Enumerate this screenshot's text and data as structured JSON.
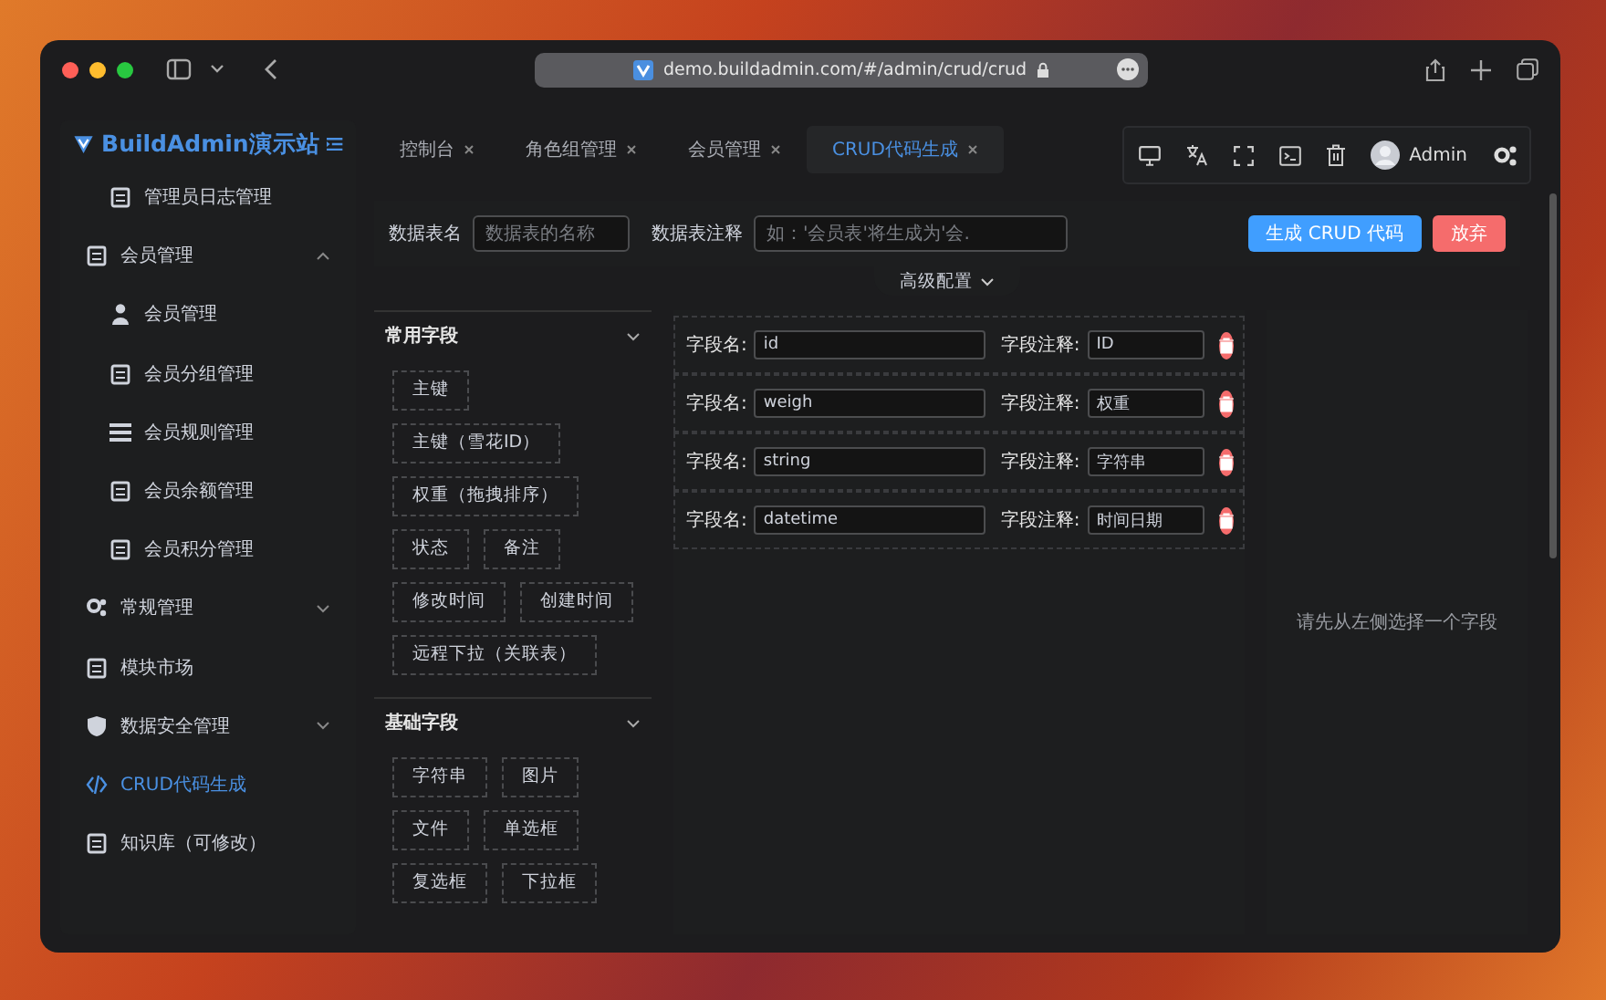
{
  "browser": {
    "url": "demo.buildadmin.com/#/admin/crud/crud"
  },
  "sidebar": {
    "logo": "BuildAdmin演示站",
    "items": [
      {
        "label": "管理员日志管理",
        "kind": "sub",
        "selected": false
      },
      {
        "label": "会员管理",
        "kind": "group",
        "expanded": true,
        "selected": false,
        "children": [
          {
            "label": "会员管理",
            "kind": "sub",
            "selected": false
          },
          {
            "label": "会员分组管理",
            "kind": "sub",
            "selected": false
          },
          {
            "label": "会员规则管理",
            "kind": "sub",
            "selected": false
          },
          {
            "label": "会员余额管理",
            "kind": "sub",
            "selected": false
          },
          {
            "label": "会员积分管理",
            "kind": "sub",
            "selected": false
          }
        ]
      },
      {
        "label": "常规管理",
        "kind": "group",
        "expanded": false,
        "selected": false
      },
      {
        "label": "模块市场",
        "kind": "item",
        "selected": false
      },
      {
        "label": "数据安全管理",
        "kind": "group",
        "expanded": false,
        "selected": false
      },
      {
        "label": "CRUD代码生成",
        "kind": "item",
        "selected": true
      },
      {
        "label": "知识库（可修改）",
        "kind": "item",
        "selected": false
      }
    ]
  },
  "tabs": [
    {
      "label": "控制台",
      "selected": false
    },
    {
      "label": "角色组管理",
      "selected": false
    },
    {
      "label": "会员管理",
      "selected": false
    },
    {
      "label": "CRUD代码生成",
      "selected": true
    }
  ],
  "user": {
    "name": "Admin"
  },
  "form": {
    "table_name": {
      "label": "数据表名",
      "placeholder": "数据表的名称"
    },
    "table_comment": {
      "label": "数据表注释",
      "placeholder": "如：'会员表'将生成为'会."
    },
    "generate_button": "生成 CRUD 代码",
    "discard_button": "放弃",
    "advanced_toggle": "高级配置"
  },
  "field_groups": [
    {
      "title": "常用字段",
      "expanded": true,
      "fields": [
        "主键",
        "主键（雪花ID）",
        "权重（拖拽排序）",
        "状态",
        "备注",
        "修改时间",
        "创建时间",
        "远程下拉（关联表）"
      ]
    },
    {
      "title": "基础字段",
      "expanded": true,
      "fields": [
        "字符串",
        "图片",
        "文件",
        "单选框",
        "复选框",
        "下拉框"
      ]
    }
  ],
  "field_rows": [
    {
      "name_label": "字段名:",
      "name": "id",
      "comment_label": "字段注释:",
      "comment": "ID"
    },
    {
      "name_label": "字段名:",
      "name": "weigh",
      "comment_label": "字段注释:",
      "comment": "权重"
    },
    {
      "name_label": "字段名:",
      "name": "string",
      "comment_label": "字段注释:",
      "comment": "字符串"
    },
    {
      "name_label": "字段名:",
      "name": "datetime",
      "comment_label": "字段注释:",
      "comment": "时间日期"
    }
  ],
  "detail_panel": {
    "hint": "请先从左侧选择一个字段"
  }
}
